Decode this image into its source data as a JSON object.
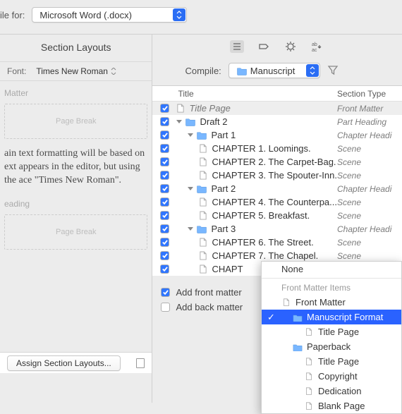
{
  "top": {
    "label": "ile for:",
    "format": "Microsoft Word (.docx)"
  },
  "left": {
    "header": "Section Layouts",
    "font_label": "Font:",
    "font_value": "Times New Roman",
    "group1": "Matter",
    "page_break": "Page Break",
    "body_text": "ain text formatting will be based on ext appears in the editor, but using the ace \"Times New Roman\".",
    "group2": "eading",
    "assign_btn": "Assign Section Layouts..."
  },
  "right": {
    "compile_label": "Compile:",
    "compile_value": "Manuscript",
    "columns": {
      "title": "Title",
      "type": "Section Type"
    },
    "rows": [
      {
        "indent": 0,
        "kind": "doc",
        "label": "Title Page",
        "type": "Front Matter",
        "chk": true,
        "sel": true,
        "ital": true
      },
      {
        "indent": 0,
        "kind": "folder",
        "label": "Draft 2",
        "type": "Part Heading",
        "chk": true,
        "expand": true
      },
      {
        "indent": 1,
        "kind": "folder",
        "label": "Part 1",
        "type": "Chapter Headi",
        "chk": true,
        "expand": true
      },
      {
        "indent": 2,
        "kind": "doc",
        "label": "CHAPTER 1. Loomings.",
        "type": "Scene",
        "chk": true
      },
      {
        "indent": 2,
        "kind": "doc",
        "label": "CHAPTER 2. The Carpet-Bag.",
        "type": "Scene",
        "chk": true
      },
      {
        "indent": 2,
        "kind": "doc",
        "label": "CHAPTER 3. The Spouter-Inn.",
        "type": "Scene",
        "chk": true
      },
      {
        "indent": 1,
        "kind": "folder",
        "label": "Part 2",
        "type": "Chapter Headi",
        "chk": true,
        "expand": true
      },
      {
        "indent": 2,
        "kind": "doc",
        "label": "CHAPTER 4. The Counterpa...",
        "type": "Scene",
        "chk": true
      },
      {
        "indent": 2,
        "kind": "doc",
        "label": "CHAPTER 5. Breakfast.",
        "type": "Scene",
        "chk": true
      },
      {
        "indent": 1,
        "kind": "folder",
        "label": "Part 3",
        "type": "Chapter Headi",
        "chk": true,
        "expand": true
      },
      {
        "indent": 2,
        "kind": "doc",
        "label": "CHAPTER 6. The Street.",
        "type": "Scene",
        "chk": true
      },
      {
        "indent": 2,
        "kind": "doc",
        "label": "CHAPTER 7. The Chapel.",
        "type": "Scene",
        "chk": true
      },
      {
        "indent": 2,
        "kind": "doc",
        "label": "CHAPT",
        "type": "",
        "chk": true
      }
    ],
    "front_matter_label": "Add front matter",
    "back_matter_label": "Add back matter"
  },
  "popup": {
    "none": "None",
    "head": "Front Matter Items",
    "items": [
      {
        "label": "Front Matter",
        "kind": "doc",
        "indent": 0
      },
      {
        "label": "Manuscript Format",
        "kind": "folder",
        "indent": 1,
        "sel": true,
        "chk": true
      },
      {
        "label": "Title Page",
        "kind": "doc",
        "indent": 2
      },
      {
        "label": "Paperback",
        "kind": "folder",
        "indent": 1
      },
      {
        "label": "Title Page",
        "kind": "doc",
        "indent": 2
      },
      {
        "label": "Copyright",
        "kind": "doc",
        "indent": 2
      },
      {
        "label": "Dedication",
        "kind": "doc",
        "indent": 2
      },
      {
        "label": "Blank Page",
        "kind": "doc",
        "indent": 2
      }
    ]
  }
}
